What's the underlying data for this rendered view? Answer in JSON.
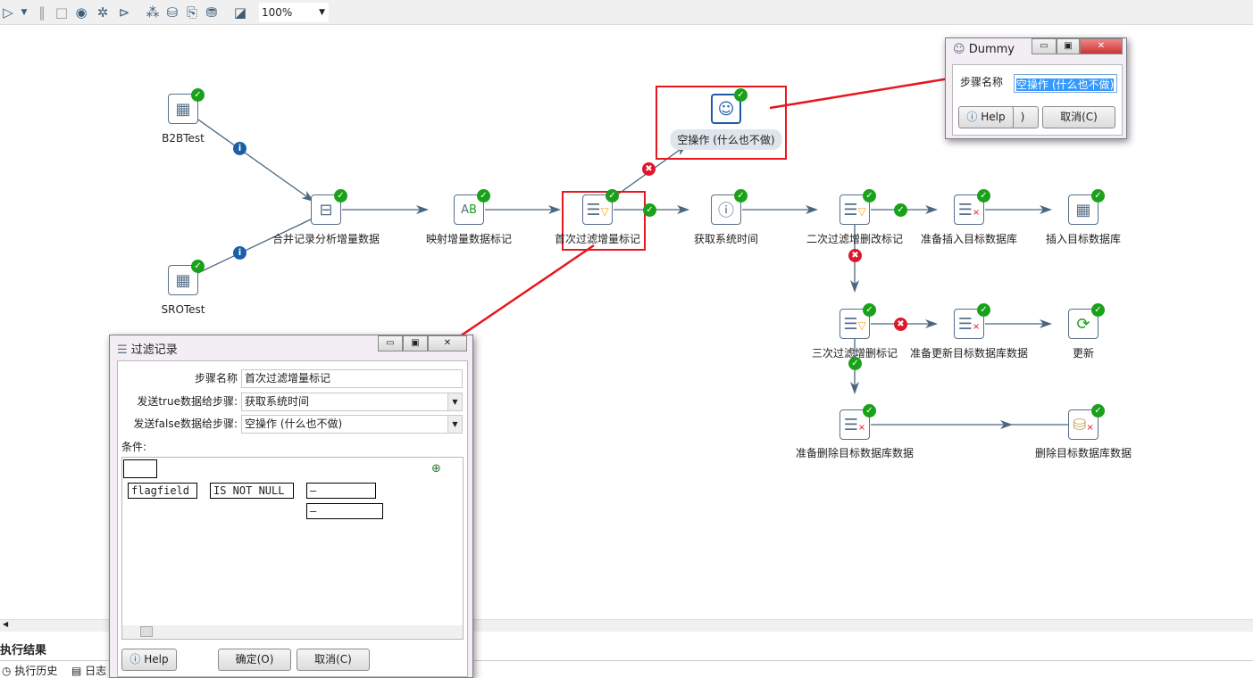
{
  "toolbar": {
    "icons": [
      "run-icon",
      "run-dropdown-icon",
      "pause-icon",
      "stop-icon",
      "preview-icon",
      "debug-icon",
      "replay-icon",
      "verify-icon",
      "impact-icon",
      "sql-icon",
      "explore-db-icon",
      "grid-icon"
    ],
    "zoom": "100%"
  },
  "canvas": {
    "nodes": {
      "b2b": "B2BTest",
      "sro": "SROTest",
      "merge": "合并记录分析增量数据",
      "map": "映射增量数据标记",
      "filter1": "首次过滤增量标记",
      "dummy": "空操作 (什么也不做)",
      "systime": "获取系统时间",
      "filter2": "二次过滤增删改标记",
      "prepins": "准备插入目标数据库",
      "insert": "插入目标数据库",
      "filter3": "三次过滤增删标记",
      "prepupd": "准备更新目标数据库数据",
      "update": "更新",
      "prepdel": "准备删除目标数据库数据",
      "delete": "删除目标数据库数据"
    },
    "colors": {
      "hop": "#4a6680",
      "ok": "#1aa11a",
      "error": "#e0162b",
      "info": "#1a5fa8",
      "annotation": "#e8161d"
    }
  },
  "bottom": {
    "title": "执行结果",
    "tabs": [
      "执行历史",
      "日志"
    ]
  },
  "filter_dialog": {
    "title": "过滤记录",
    "step_name_label": "步骤名称",
    "step_name": "首次过滤增量标记",
    "true_label": "发送true数据给步骤:",
    "true_value": "获取系统时间",
    "false_label": "发送false数据给步骤:",
    "false_value": "空操作 (什么也不做)",
    "condition_label": "条件:",
    "condition": {
      "field": "flagfield",
      "operator": "IS NOT NULL",
      "value1": "–",
      "value2": "–"
    },
    "help": "Help",
    "ok": "确定(O)",
    "cancel": "取消(C)"
  },
  "dummy_dialog": {
    "title": "Dummy",
    "step_name_label": "步骤名称",
    "step_name": "空操作 (什么也不做)",
    "help": "Help",
    "ok_partial": ")",
    "cancel": "取消(C)"
  }
}
